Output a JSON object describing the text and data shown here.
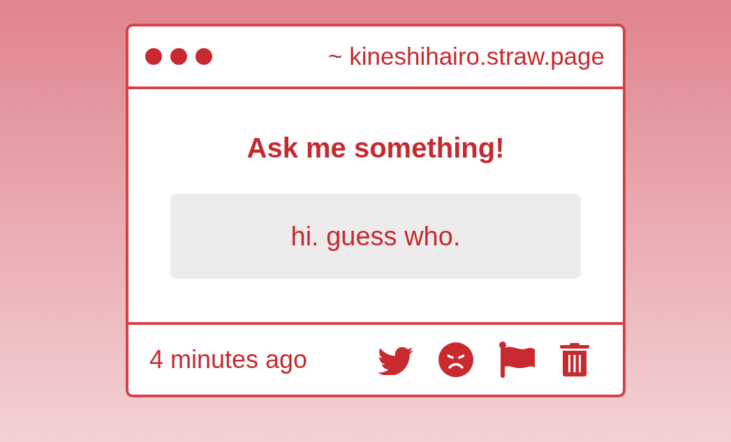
{
  "window": {
    "url": "~ kineshihairo.straw.page"
  },
  "question": {
    "heading": "Ask me something!",
    "text": "hi. guess who."
  },
  "footer": {
    "time": "4 minutes ago"
  }
}
